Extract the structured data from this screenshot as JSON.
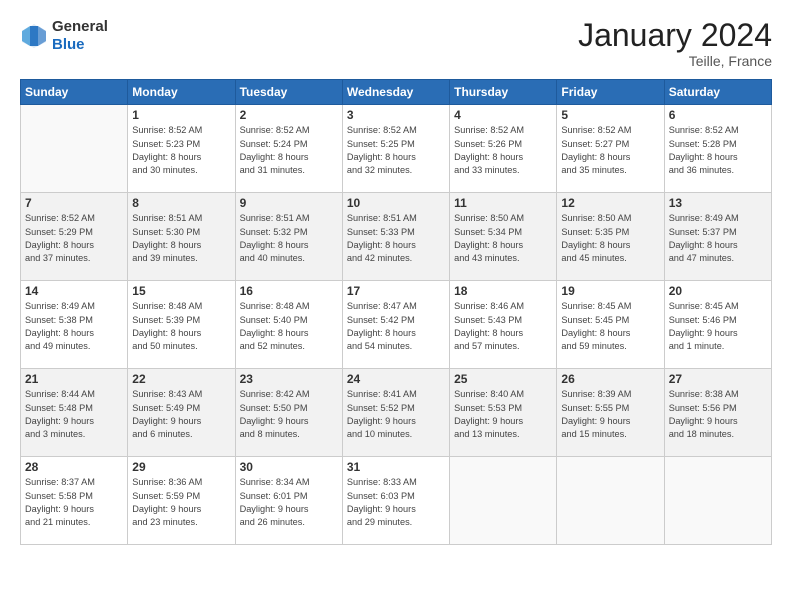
{
  "header": {
    "logo_line1": "General",
    "logo_line2": "Blue",
    "month": "January 2024",
    "location": "Teille, France"
  },
  "weekdays": [
    "Sunday",
    "Monday",
    "Tuesday",
    "Wednesday",
    "Thursday",
    "Friday",
    "Saturday"
  ],
  "weeks": [
    [
      {
        "day": "",
        "info": ""
      },
      {
        "day": "1",
        "info": "Sunrise: 8:52 AM\nSunset: 5:23 PM\nDaylight: 8 hours\nand 30 minutes."
      },
      {
        "day": "2",
        "info": "Sunrise: 8:52 AM\nSunset: 5:24 PM\nDaylight: 8 hours\nand 31 minutes."
      },
      {
        "day": "3",
        "info": "Sunrise: 8:52 AM\nSunset: 5:25 PM\nDaylight: 8 hours\nand 32 minutes."
      },
      {
        "day": "4",
        "info": "Sunrise: 8:52 AM\nSunset: 5:26 PM\nDaylight: 8 hours\nand 33 minutes."
      },
      {
        "day": "5",
        "info": "Sunrise: 8:52 AM\nSunset: 5:27 PM\nDaylight: 8 hours\nand 35 minutes."
      },
      {
        "day": "6",
        "info": "Sunrise: 8:52 AM\nSunset: 5:28 PM\nDaylight: 8 hours\nand 36 minutes."
      }
    ],
    [
      {
        "day": "7",
        "info": "Sunrise: 8:52 AM\nSunset: 5:29 PM\nDaylight: 8 hours\nand 37 minutes."
      },
      {
        "day": "8",
        "info": "Sunrise: 8:51 AM\nSunset: 5:30 PM\nDaylight: 8 hours\nand 39 minutes."
      },
      {
        "day": "9",
        "info": "Sunrise: 8:51 AM\nSunset: 5:32 PM\nDaylight: 8 hours\nand 40 minutes."
      },
      {
        "day": "10",
        "info": "Sunrise: 8:51 AM\nSunset: 5:33 PM\nDaylight: 8 hours\nand 42 minutes."
      },
      {
        "day": "11",
        "info": "Sunrise: 8:50 AM\nSunset: 5:34 PM\nDaylight: 8 hours\nand 43 minutes."
      },
      {
        "day": "12",
        "info": "Sunrise: 8:50 AM\nSunset: 5:35 PM\nDaylight: 8 hours\nand 45 minutes."
      },
      {
        "day": "13",
        "info": "Sunrise: 8:49 AM\nSunset: 5:37 PM\nDaylight: 8 hours\nand 47 minutes."
      }
    ],
    [
      {
        "day": "14",
        "info": "Sunrise: 8:49 AM\nSunset: 5:38 PM\nDaylight: 8 hours\nand 49 minutes."
      },
      {
        "day": "15",
        "info": "Sunrise: 8:48 AM\nSunset: 5:39 PM\nDaylight: 8 hours\nand 50 minutes."
      },
      {
        "day": "16",
        "info": "Sunrise: 8:48 AM\nSunset: 5:40 PM\nDaylight: 8 hours\nand 52 minutes."
      },
      {
        "day": "17",
        "info": "Sunrise: 8:47 AM\nSunset: 5:42 PM\nDaylight: 8 hours\nand 54 minutes."
      },
      {
        "day": "18",
        "info": "Sunrise: 8:46 AM\nSunset: 5:43 PM\nDaylight: 8 hours\nand 57 minutes."
      },
      {
        "day": "19",
        "info": "Sunrise: 8:45 AM\nSunset: 5:45 PM\nDaylight: 8 hours\nand 59 minutes."
      },
      {
        "day": "20",
        "info": "Sunrise: 8:45 AM\nSunset: 5:46 PM\nDaylight: 9 hours\nand 1 minute."
      }
    ],
    [
      {
        "day": "21",
        "info": "Sunrise: 8:44 AM\nSunset: 5:48 PM\nDaylight: 9 hours\nand 3 minutes."
      },
      {
        "day": "22",
        "info": "Sunrise: 8:43 AM\nSunset: 5:49 PM\nDaylight: 9 hours\nand 6 minutes."
      },
      {
        "day": "23",
        "info": "Sunrise: 8:42 AM\nSunset: 5:50 PM\nDaylight: 9 hours\nand 8 minutes."
      },
      {
        "day": "24",
        "info": "Sunrise: 8:41 AM\nSunset: 5:52 PM\nDaylight: 9 hours\nand 10 minutes."
      },
      {
        "day": "25",
        "info": "Sunrise: 8:40 AM\nSunset: 5:53 PM\nDaylight: 9 hours\nand 13 minutes."
      },
      {
        "day": "26",
        "info": "Sunrise: 8:39 AM\nSunset: 5:55 PM\nDaylight: 9 hours\nand 15 minutes."
      },
      {
        "day": "27",
        "info": "Sunrise: 8:38 AM\nSunset: 5:56 PM\nDaylight: 9 hours\nand 18 minutes."
      }
    ],
    [
      {
        "day": "28",
        "info": "Sunrise: 8:37 AM\nSunset: 5:58 PM\nDaylight: 9 hours\nand 21 minutes."
      },
      {
        "day": "29",
        "info": "Sunrise: 8:36 AM\nSunset: 5:59 PM\nDaylight: 9 hours\nand 23 minutes."
      },
      {
        "day": "30",
        "info": "Sunrise: 8:34 AM\nSunset: 6:01 PM\nDaylight: 9 hours\nand 26 minutes."
      },
      {
        "day": "31",
        "info": "Sunrise: 8:33 AM\nSunset: 6:03 PM\nDaylight: 9 hours\nand 29 minutes."
      },
      {
        "day": "",
        "info": ""
      },
      {
        "day": "",
        "info": ""
      },
      {
        "day": "",
        "info": ""
      }
    ]
  ]
}
